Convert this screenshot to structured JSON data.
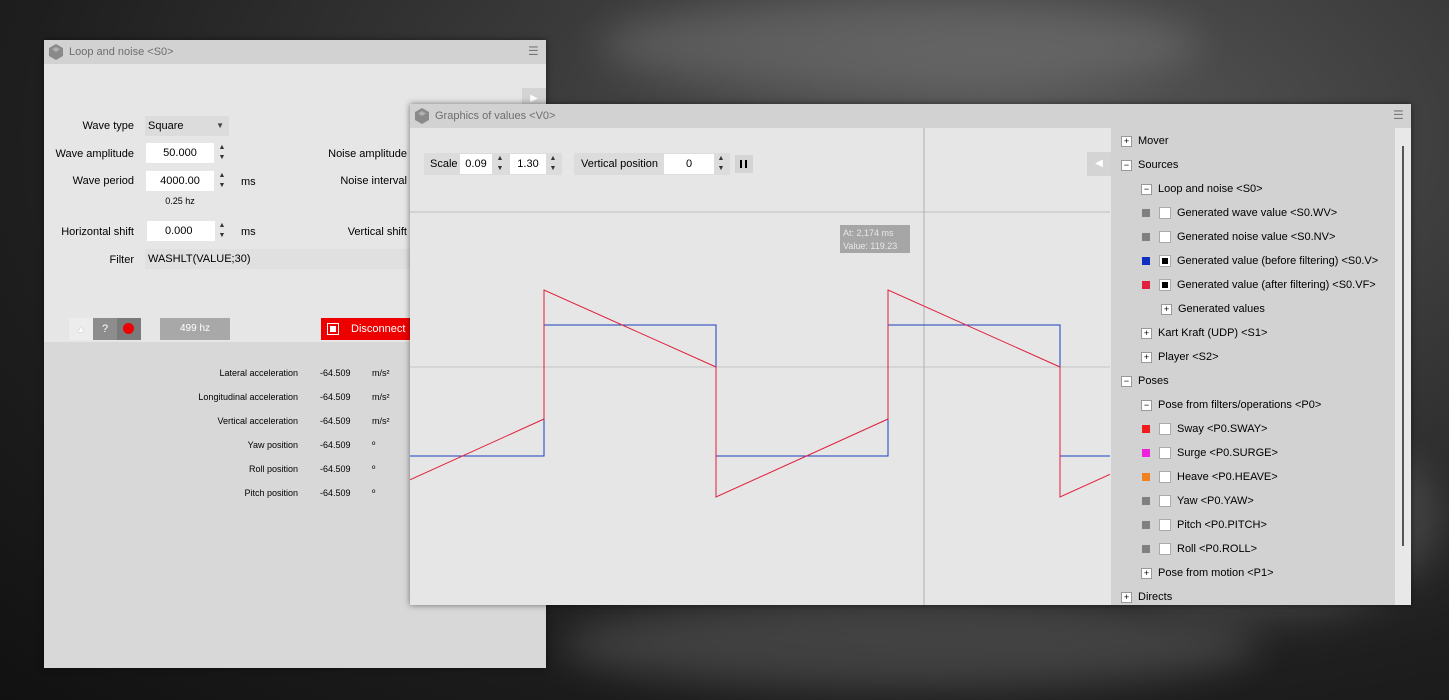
{
  "loop_window": {
    "title": "Loop and noise <S0>",
    "wave_type_label": "Wave type",
    "wave_type_value": "Square",
    "wave_amplitude_label": "Wave amplitude",
    "wave_amplitude_value": "50.000",
    "wave_period_label": "Wave period",
    "wave_period_value": "4000.00",
    "wave_period_unit": "ms",
    "frequency_text": "0.25 hz",
    "noise_amplitude_label": "Noise amplitude",
    "noise_interval_label": "Noise interval",
    "horizontal_shift_label": "Horizontal shift",
    "horizontal_shift_value": "0.000",
    "horizontal_shift_unit": "ms",
    "vertical_shift_label": "Vertical shift",
    "filter_label": "Filter",
    "filter_value": "WASHLT(VALUE;30)",
    "help_label": "?",
    "hz_label": "499 hz",
    "disconnect_label": "Disconnect",
    "sensors": [
      {
        "label": "Lateral acceleration",
        "value": "-64.509",
        "unit": "m/s²"
      },
      {
        "label": "Longitudinal acceleration",
        "value": "-64.509",
        "unit": "m/s²"
      },
      {
        "label": "Vertical acceleration",
        "value": "-64.509",
        "unit": "m/s²"
      },
      {
        "label": "Yaw position",
        "value": "-64.509",
        "unit": "º"
      },
      {
        "label": "Roll position",
        "value": "-64.509",
        "unit": "º"
      },
      {
        "label": "Pitch position",
        "value": "-64.509",
        "unit": "º"
      }
    ]
  },
  "graph_window": {
    "title": "Graphics of values <V0>",
    "scale_label": "Scale",
    "scale_min": "0.09",
    "scale_max": "1.30",
    "vertical_position_label": "Vertical position",
    "vertical_position_value": "0",
    "tooltip_at": "At: 2,174 ms",
    "tooltip_value": "Value: 119.23",
    "colors": {
      "before_filtering": "#1a3fbf",
      "after_filtering": "#e0203c"
    }
  },
  "tree": [
    {
      "label": "Mover",
      "expander": "+",
      "indent": 0
    },
    {
      "label": "Sources",
      "expander": "−",
      "indent": 0
    },
    {
      "label": "Loop and noise <S0>",
      "expander": "−",
      "indent": 1
    },
    {
      "label": "Generated wave value <S0.WV>",
      "indent": 2,
      "color": "#808080",
      "checked": false
    },
    {
      "label": "Generated noise value <S0.NV>",
      "indent": 2,
      "color": "#808080",
      "checked": false
    },
    {
      "label": "Generated value (before filtering) <S0.V>",
      "indent": 2,
      "color": "#1030c0",
      "checked": true
    },
    {
      "label": "Generated value (after filtering) <S0.VF>",
      "indent": 2,
      "color": "#e0203c",
      "checked": true
    },
    {
      "label": "Generated values",
      "expander": "+",
      "indent": 2
    },
    {
      "label": "Kart Kraft (UDP) <S1>",
      "expander": "+",
      "indent": 1
    },
    {
      "label": "Player <S2>",
      "expander": "+",
      "indent": 1
    },
    {
      "label": "Poses",
      "expander": "−",
      "indent": 0
    },
    {
      "label": "Pose from filters/operations <P0>",
      "expander": "−",
      "indent": 1
    },
    {
      "label": "Sway <P0.SWAY>",
      "indent": 2,
      "color": "#ee1c1c",
      "checked": false
    },
    {
      "label": "Surge <P0.SURGE>",
      "indent": 2,
      "color": "#ee22dd",
      "checked": false
    },
    {
      "label": "Heave <P0.HEAVE>",
      "indent": 2,
      "color": "#f08020",
      "checked": false
    },
    {
      "label": "Yaw <P0.YAW>",
      "indent": 2,
      "color": "#808080",
      "checked": false
    },
    {
      "label": "Pitch <P0.PITCH>",
      "indent": 2,
      "color": "#808080",
      "checked": false
    },
    {
      "label": "Roll <P0.ROLL>",
      "indent": 2,
      "color": "#808080",
      "checked": false
    },
    {
      "label": "Pose from motion <P1>",
      "expander": "+",
      "indent": 1
    },
    {
      "label": "Directs",
      "expander": "+",
      "indent": 0
    }
  ]
}
